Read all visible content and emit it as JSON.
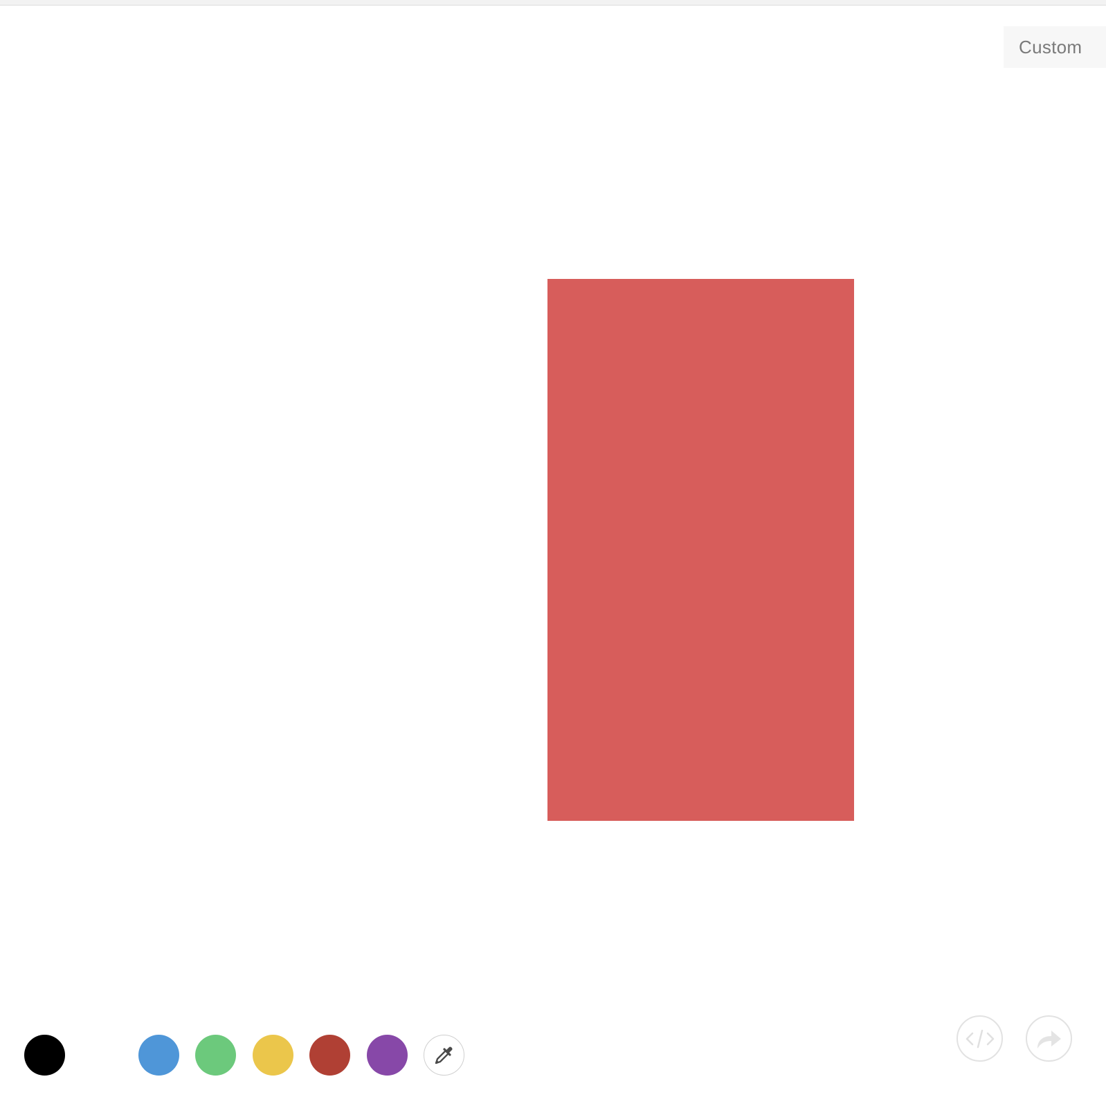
{
  "header": {
    "custom_label": "Custom"
  },
  "canvas": {
    "shape_color": "#d75d5b"
  },
  "palette": {
    "swatches": [
      {
        "name": "swatch-black",
        "color": "#000000"
      },
      {
        "name": "swatch-white",
        "color": "#ffffff"
      },
      {
        "name": "swatch-blue",
        "color": "#4f96d8"
      },
      {
        "name": "swatch-green",
        "color": "#6cc97c"
      },
      {
        "name": "swatch-yellow",
        "color": "#ebc64b"
      },
      {
        "name": "swatch-red",
        "color": "#b04034"
      },
      {
        "name": "swatch-purple",
        "color": "#8748a8"
      }
    ],
    "picker_icon": "eyedropper-icon"
  },
  "actions": {
    "embed_icon": "code-icon",
    "share_icon": "share-arrow-icon"
  }
}
